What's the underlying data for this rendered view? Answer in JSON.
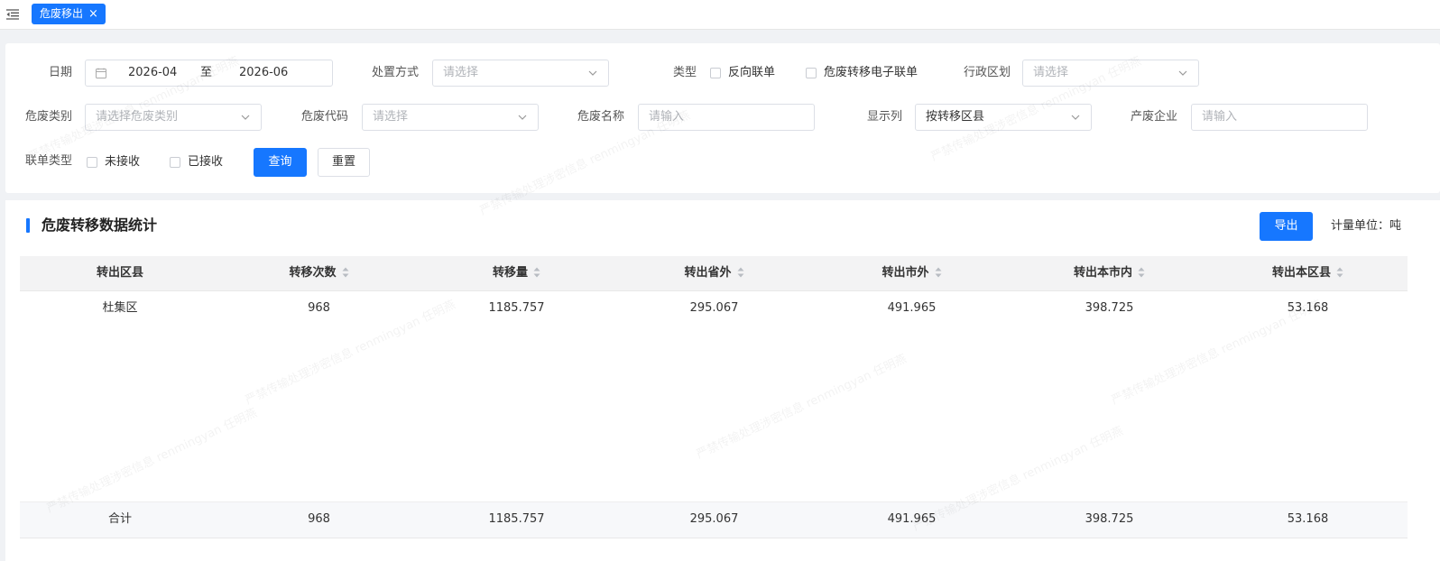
{
  "tabs": [
    {
      "label": "危废移出",
      "active": true
    }
  ],
  "filters": {
    "date": {
      "label": "日期",
      "start": "2026-04",
      "separator": "至",
      "end": "2026-06"
    },
    "disposal": {
      "label": "处置方式",
      "placeholder": "请选择"
    },
    "type": {
      "label": "类型",
      "options": [
        "反向联单",
        "危废转移电子联单"
      ]
    },
    "region": {
      "label": "行政区划",
      "placeholder": "请选择"
    },
    "waste_category": {
      "label": "危废类别",
      "placeholder": "请选择危废类别"
    },
    "waste_code": {
      "label": "危废代码",
      "placeholder": "请选择"
    },
    "waste_name": {
      "label": "危废名称",
      "placeholder": "请输入"
    },
    "display_column": {
      "label": "显示列",
      "value": "按转移区县"
    },
    "producer": {
      "label": "产废企业",
      "placeholder": "请输入"
    },
    "manifest_type": {
      "label": "联单类型",
      "options": [
        "未接收",
        "已接收"
      ]
    },
    "query_label": "查询",
    "reset_label": "重置"
  },
  "panel": {
    "title": "危废转移数据统计",
    "export_label": "导出",
    "unit_label": "计量单位：吨"
  },
  "table": {
    "columns": [
      "转出区县",
      "转移次数",
      "转移量",
      "转出省外",
      "转出市外",
      "转出本市内",
      "转出本区县"
    ],
    "rows": [
      [
        "杜集区",
        "968",
        "1185.757",
        "295.067",
        "491.965",
        "398.725",
        "53.168"
      ]
    ],
    "total": [
      "合计",
      "968",
      "1185.757",
      "295.067",
      "491.965",
      "398.725",
      "53.168"
    ]
  },
  "watermark": "严禁传输处理涉密信息 renmingyan 任明燕",
  "colors": {
    "accent": "#1677ff",
    "header_bg": "#f3f3f4",
    "page_bg": "#f0f2f5"
  }
}
